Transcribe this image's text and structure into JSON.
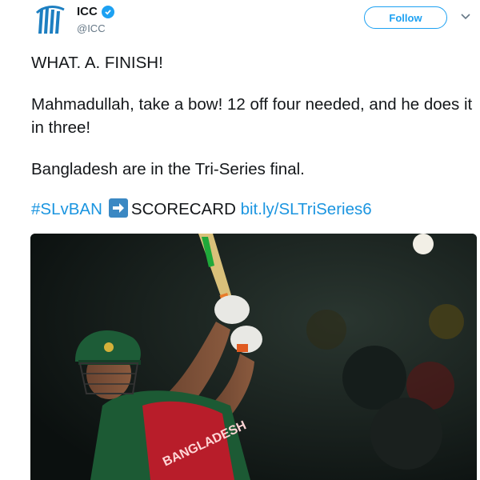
{
  "author": {
    "display_name": "ICC",
    "handle": "@ICC",
    "verified": true,
    "avatar_icon": "icc-logo-icon"
  },
  "actions": {
    "follow_label": "Follow",
    "more_icon": "chevron-down-icon"
  },
  "tweet": {
    "line1": "WHAT. A. FINISH!",
    "line2": "Mahmadullah, take a bow! 12 off four needed, and he does it in three!",
    "line3": "Bangladesh are in the Tri-Series final.",
    "hashtag": "#SLvBAN",
    "arrow_icon": "right-arrow-emoji-icon",
    "scorecard_label": "SCORECARD",
    "link": "bit.ly/SLTriSeries6"
  },
  "media": {
    "kind": "photo",
    "subject": "batsman-in-green-helmet",
    "jersey_text": "BANGLADESH"
  },
  "colors": {
    "link": "#1b95e0",
    "accent": "#1da1f2",
    "text": "#14171a",
    "muted": "#657786"
  }
}
